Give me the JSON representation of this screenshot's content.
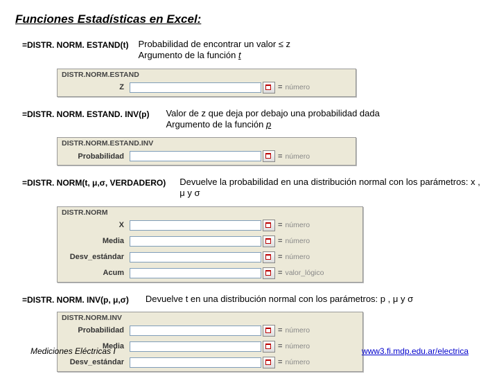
{
  "title": "Funciones Estadísticas en Excel:",
  "sections": [
    {
      "formula": "=DISTR. NORM. ESTAND(t)",
      "desc_line1": "Probabilidad de encontrar un valor ≤ z",
      "desc_line2_a": "Argumento de la función ",
      "desc_line2_var": "t",
      "dialog": {
        "title": "DISTR.NORM.ESTAND",
        "rows": [
          {
            "label": "Z",
            "hint": "número"
          }
        ]
      }
    },
    {
      "formula": "=DISTR. NORM. ESTAND. INV(p)",
      "desc_line1": "Valor de z que deja por debajo una probabilidad dada",
      "desc_line2_a": "Argumento de la función ",
      "desc_line2_var": "p",
      "dialog": {
        "title": "DISTR.NORM.ESTAND.INV",
        "rows": [
          {
            "label": "Probabilidad",
            "hint": "número"
          }
        ]
      }
    },
    {
      "formula": "=DISTR. NORM(t, μ,σ, VERDADERO)",
      "desc_single": "Devuelve la probabilidad en una distribución normal con los parámetros:  x ,  μ  y  σ",
      "dialog": {
        "title": "DISTR.NORM",
        "rows": [
          {
            "label": "X",
            "hint": "número"
          },
          {
            "label": "Media",
            "hint": "número"
          },
          {
            "label": "Desv_estándar",
            "hint": "número"
          },
          {
            "label": "Acum",
            "hint": "valor_lógico"
          }
        ]
      }
    },
    {
      "formula": "=DISTR. NORM. INV(p, μ,σ)",
      "desc_single": "Devuelve t en una distribución normal con los parámetros:  p ,  μ  y  σ",
      "dialog": {
        "title": "DISTR.NORM.INV",
        "rows": [
          {
            "label": "Probabilidad",
            "hint": "número"
          },
          {
            "label": "Media",
            "hint": "número"
          },
          {
            "label": "Desv_estándar",
            "hint": "número"
          }
        ]
      }
    }
  ],
  "footer_left": "Mediciones Eléctricas I",
  "footer_link": "www3.fi.mdp.edu.ar/electrica"
}
